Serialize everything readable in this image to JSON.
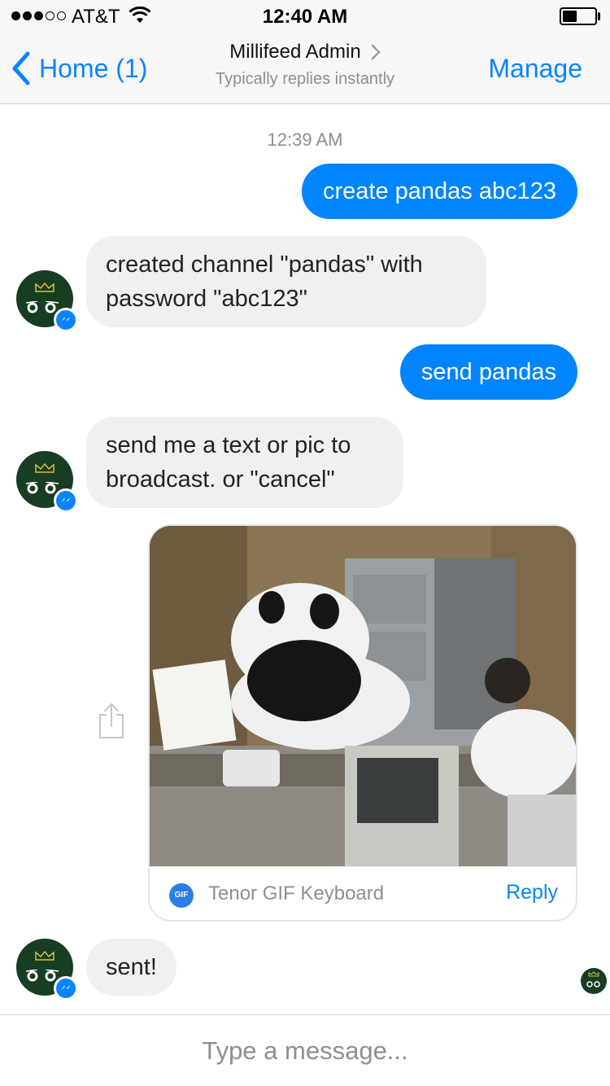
{
  "status_bar": {
    "carrier": "AT&T",
    "time": "12:40 AM",
    "signal_bars_filled": 3,
    "signal_bars_total": 5,
    "battery_level": 0.45
  },
  "nav": {
    "back_label": "Home (1)",
    "title": "Millifeed Admin",
    "subtitle": "Typically replies instantly",
    "manage_label": "Manage"
  },
  "chat": {
    "timestamp": "12:39 AM",
    "messages": [
      {
        "direction": "outgoing",
        "text": "create pandas abc123"
      },
      {
        "direction": "incoming",
        "line1": "created channel \"pandas\" with",
        "line2": "password \"abc123\""
      },
      {
        "direction": "outgoing",
        "text": "send pandas"
      },
      {
        "direction": "incoming",
        "line1": "send me a text or pic to",
        "line2": "broadcast. or \"cancel\""
      },
      {
        "direction": "outgoing",
        "type": "gif",
        "source": "Tenor GIF Keyboard",
        "action": "Reply",
        "logo_text": "GIF"
      },
      {
        "direction": "incoming",
        "text": "sent!"
      }
    ]
  },
  "composer": {
    "placeholder": "Type a message..."
  },
  "colors": {
    "accent": "#0a84ff",
    "outgoing_bubble": "#0084ff",
    "incoming_bubble": "#f1f0f0",
    "avatar_bg": "#173d22",
    "bar_bg": "#f7f7f7"
  },
  "icons": {
    "back": "chevron-left-icon",
    "title_chevron": "chevron-right-icon",
    "wifi": "wifi-icon",
    "battery": "battery-icon",
    "share": "share-icon",
    "messenger_badge": "messenger-badge-icon"
  }
}
